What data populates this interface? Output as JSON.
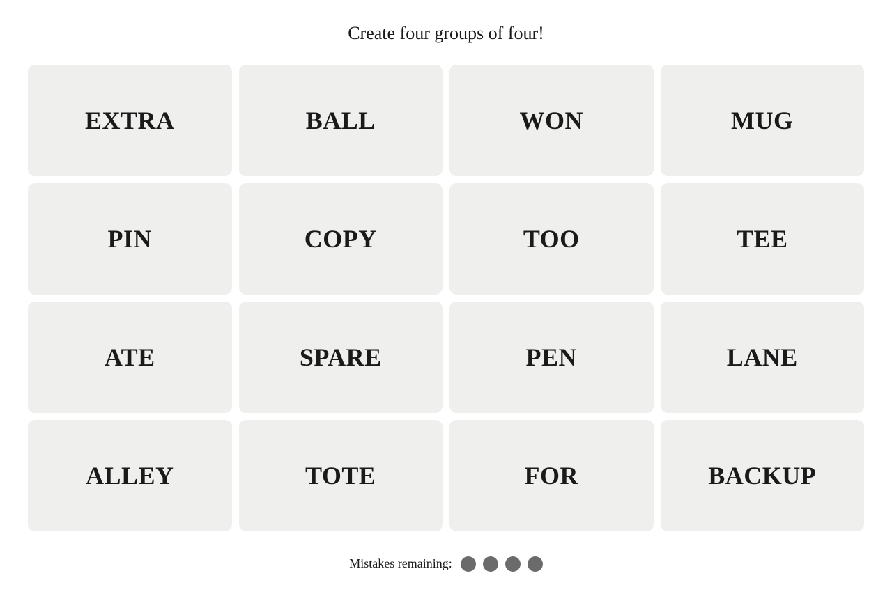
{
  "header": {
    "title": "Create four groups of four!"
  },
  "grid": {
    "words": [
      {
        "id": "extra",
        "label": "EXTRA"
      },
      {
        "id": "ball",
        "label": "BALL"
      },
      {
        "id": "won",
        "label": "WON"
      },
      {
        "id": "mug",
        "label": "MUG"
      },
      {
        "id": "pin",
        "label": "PIN"
      },
      {
        "id": "copy",
        "label": "COPY"
      },
      {
        "id": "too",
        "label": "TOO"
      },
      {
        "id": "tee",
        "label": "TEE"
      },
      {
        "id": "ate",
        "label": "ATE"
      },
      {
        "id": "spare",
        "label": "SPARE"
      },
      {
        "id": "pen",
        "label": "PEN"
      },
      {
        "id": "lane",
        "label": "LANE"
      },
      {
        "id": "alley",
        "label": "ALLEY"
      },
      {
        "id": "tote",
        "label": "TOTE"
      },
      {
        "id": "for",
        "label": "FOR"
      },
      {
        "id": "backup",
        "label": "BACKUP"
      }
    ]
  },
  "mistakes": {
    "label": "Mistakes remaining:",
    "count": 4
  }
}
